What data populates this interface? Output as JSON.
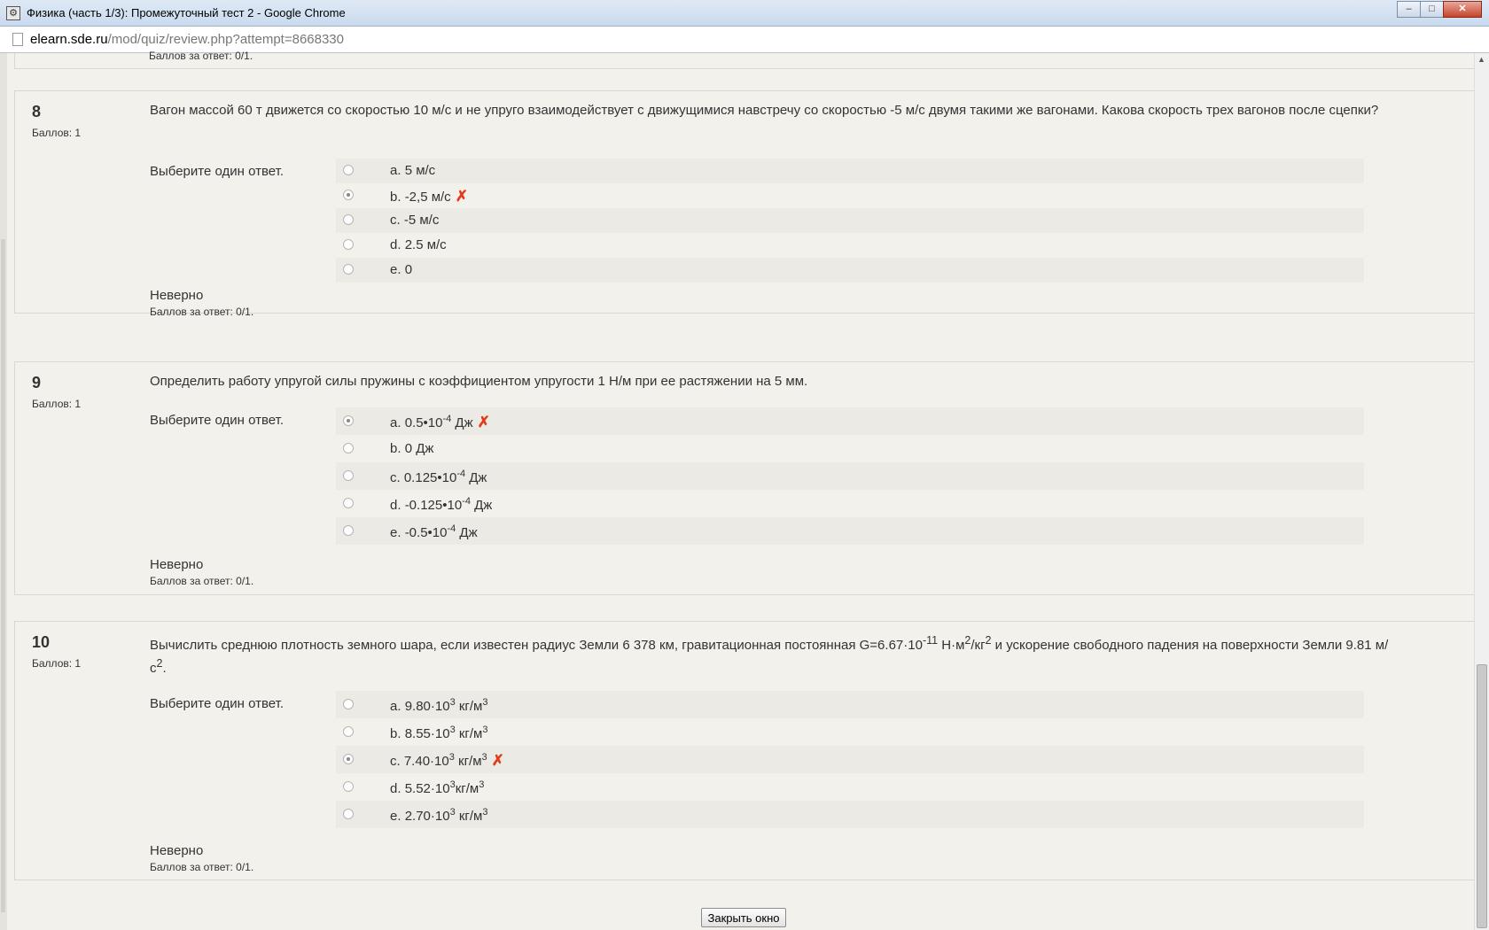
{
  "window": {
    "title": "Физика (часть 1/3): Промежуточный тест 2 - Google Chrome",
    "minimize": "–",
    "maximize": "□",
    "close": "✕"
  },
  "address": {
    "host": "elearn.sde.ru",
    "path": "/mod/quiz/review.php?attempt=8668330"
  },
  "prev_question": {
    "marks": "Баллов за ответ: 0/1."
  },
  "questions": [
    {
      "number": "8",
      "grade": "Баллов: 1",
      "text": "Вагон массой 60 т движется со скоростью 10 м/с и не упруго взаимодействует с движущимися навстречу со скоростью -5 м/с двумя такими же вагонами. Какова скорость трех вагонов после сцепки?",
      "prompt": "Выберите один ответ.",
      "answers": [
        {
          "letter": "a.",
          "text": "5 м/с",
          "checked": false,
          "wrong": false
        },
        {
          "letter": "b.",
          "text": "-2,5 м/с",
          "checked": true,
          "wrong": true
        },
        {
          "letter": "c.",
          "text": "-5 м/с",
          "checked": false,
          "wrong": false
        },
        {
          "letter": "d.",
          "text": "2.5 м/с",
          "checked": false,
          "wrong": false
        },
        {
          "letter": "e.",
          "text": "0",
          "checked": false,
          "wrong": false
        }
      ],
      "outcome": "Неверно",
      "marks": "Баллов за ответ: 0/1."
    },
    {
      "number": "9",
      "grade": "Баллов: 1",
      "text": "Определить работу упругой силы пружины с коэффициентом упругости 1 Н/м при ее растяжении на 5 мм.",
      "prompt": "Выберите один ответ.",
      "answers": [
        {
          "letter": "a.",
          "base": "0.5•10",
          "sup": "-4",
          "unit": " Дж",
          "checked": true,
          "wrong": true
        },
        {
          "letter": "b.",
          "text": "0 Дж",
          "checked": false,
          "wrong": false
        },
        {
          "letter": "c.",
          "base": "0.125•10",
          "sup": "-4",
          "unit": " Дж",
          "checked": false,
          "wrong": false
        },
        {
          "letter": "d.",
          "base": "-0.125•10",
          "sup": "-4",
          "unit": " Дж",
          "checked": false,
          "wrong": false
        },
        {
          "letter": "e.",
          "base": "-0.5•10",
          "sup": "-4",
          "unit": " Дж",
          "checked": false,
          "wrong": false
        }
      ],
      "outcome": "Неверно",
      "marks": "Баллов за ответ: 0/1."
    },
    {
      "number": "10",
      "grade": "Баллов: 1",
      "text_parts": {
        "p1": "Вычислить среднюю плотность земного шара, если известен радиус Земли 6 378 км, гравитационная постоянная G=6.67·10",
        "s1": "-11",
        "p2": " Н·м",
        "s2": "2",
        "p3": "/кг",
        "s3": "2",
        "p4": " и ускорение свободного падения на поверхности Земли 9.81 м/с",
        "s4": "2",
        "p5": "."
      },
      "prompt": "Выберите один ответ.",
      "answers": [
        {
          "letter": "a.",
          "base": "9.80·10",
          "sup": "3",
          "unit": " кг/м",
          "unitsup": "3",
          "checked": false,
          "wrong": false
        },
        {
          "letter": "b.",
          "base": "8.55·10",
          "sup": "3",
          "unit": " кг/м",
          "unitsup": "3",
          "checked": false,
          "wrong": false
        },
        {
          "letter": "c.",
          "base": "7.40·10",
          "sup": "3",
          "unit": " кг/м",
          "unitsup": "3",
          "checked": true,
          "wrong": true
        },
        {
          "letter": "d.",
          "base": "5.52·10",
          "sup": "3",
          "unit": "кг/м",
          "unitsup": "3",
          "checked": false,
          "wrong": false
        },
        {
          "letter": "e.",
          "base": "2.70·10",
          "sup": "3",
          "unit": " кг/м",
          "unitsup": "3",
          "checked": false,
          "wrong": false
        }
      ],
      "outcome": "Неверно",
      "marks": "Баллов за ответ: 0/1."
    }
  ],
  "wrong_mark": "✗",
  "close_button": "Закрыть окно",
  "colors": {
    "wrong": "#e53a1a",
    "page_bg": "#f2f1ec",
    "row_alt": "#ebeae4"
  }
}
